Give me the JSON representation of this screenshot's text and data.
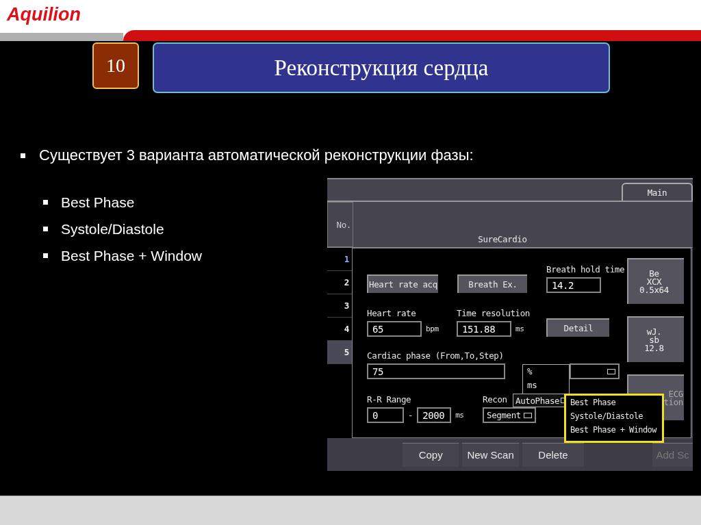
{
  "brand": "Aquilion",
  "slide_number": "10",
  "title": "Реконструкция сердца",
  "bullet": "Существует 3 варианта автоматической реконструкции фазы:",
  "sub_bullets": [
    "Best Phase",
    "Systole/Diastole",
    "Best Phase + Window"
  ],
  "scanner": {
    "tabs": [
      {
        "label": "Main",
        "selected": true
      }
    ],
    "no_header": "No.",
    "section_title": "SureCardio",
    "rows": [
      {
        "label": "1",
        "selected": false
      },
      {
        "label": "2",
        "selected": false
      },
      {
        "label": "3",
        "selected": false
      },
      {
        "label": "4",
        "selected": false
      },
      {
        "label": "5",
        "selected": true
      }
    ],
    "heart_rate_acq_button": "Heart rate acq",
    "breath_ex_button": "Breath Ex.",
    "breath_hold": {
      "label": "Breath hold time",
      "value": "14.2"
    },
    "heart_rate": {
      "label": "Heart rate",
      "value": "65",
      "unit": "bpm"
    },
    "time_resolution": {
      "label": "Time resolution",
      "value": "151.88",
      "unit": "ms"
    },
    "detail_button": "Detail",
    "cardiac_phase": {
      "label": "Cardiac phase (From,To,Step)",
      "value": "75"
    },
    "phase_units": [
      "%",
      "ms"
    ],
    "rr_range": {
      "label": "R-R Range",
      "from": "0",
      "separator": "-",
      "to": "2000",
      "unit": "ms"
    },
    "recon_mode": {
      "label": "Recon",
      "value": "Segment"
    },
    "autophase": "AutoPhase",
    "autophase_options": [
      "Best Phase",
      "Systole/Diastole",
      "Best Phase + Window"
    ],
    "side_buttons": [
      {
        "lines": [
          "Be",
          "XCX",
          "0.5x64"
        ]
      },
      {
        "lines": [
          "wJ.",
          "sb",
          "12.8"
        ]
      },
      {
        "lines": [
          "ECG",
          "tion"
        ]
      }
    ],
    "bottom_buttons": [
      {
        "label": "Copy",
        "disabled": false
      },
      {
        "label": "New Scan",
        "disabled": false
      },
      {
        "label": "Delete",
        "disabled": false
      },
      {
        "label": "Add Sc",
        "disabled": true
      }
    ]
  }
}
